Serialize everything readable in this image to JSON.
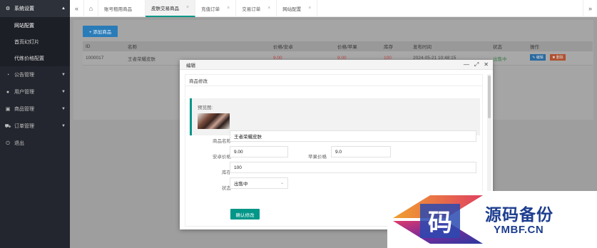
{
  "sidebar": {
    "groups": [
      {
        "label": "系统设置",
        "icon": "gear-icon",
        "arrow": "▲"
      },
      {
        "label": "公告管理",
        "icon": "bell-icon",
        "arrow": "▼"
      },
      {
        "label": "用户管理",
        "icon": "user-icon",
        "arrow": "▼"
      },
      {
        "label": "商品管理",
        "icon": "box-icon",
        "arrow": "▼"
      },
      {
        "label": "订单管理",
        "icon": "cart-icon",
        "arrow": "▼"
      },
      {
        "label": "退出",
        "icon": "power-icon",
        "arrow": ""
      }
    ],
    "sub_items": [
      {
        "label": "网站配置"
      },
      {
        "label": "首页幻灯片"
      },
      {
        "label": "代练价格配置"
      }
    ]
  },
  "topbar": {
    "prev": "«",
    "home_icon": "⌂",
    "next": "»",
    "tabs": [
      {
        "label": "账号租用商品",
        "close": ""
      },
      {
        "label": "皮肤交易商品",
        "close": "×"
      },
      {
        "label": "充值订单",
        "close": "×"
      },
      {
        "label": "交易订单",
        "close": "×"
      },
      {
        "label": "网站配置",
        "close": "×"
      }
    ]
  },
  "list": {
    "add_button": "+ 添加商品",
    "columns": [
      "ID",
      "名称",
      "价格/安卓",
      "价格/苹果",
      "库存",
      "发布时间",
      "状态",
      "操作"
    ],
    "rows": [
      {
        "id": "1000017",
        "name": "王者荣耀皮肤",
        "price_android": "9.00",
        "price_apple": "9.00",
        "stock": "100",
        "time": "2024-05-21 10:48:15",
        "status": "出售中",
        "edit": "✎ 编辑",
        "delete": "✖ 删除"
      }
    ]
  },
  "modal": {
    "title": "编辑",
    "controls": [
      "—",
      "⤢",
      "✕"
    ],
    "subtitle": "商品修改",
    "preview_label": "预览图:",
    "fields": {
      "name_label": "商品名称",
      "name_value": "王者荣耀皮肤",
      "android_label": "安卓价格",
      "android_value": "9.00",
      "apple_label": "苹果价格",
      "apple_value": "9.0",
      "stock_label": "库存",
      "stock_value": "100",
      "status_label": "状态",
      "status_value": "出售中",
      "status_arrow": "⌄"
    },
    "confirm_button": "确认修改"
  },
  "watermark": {
    "logo_char": "码",
    "text_cn": "源码备份",
    "text_en": "YMBF.CN"
  },
  "colors": {
    "sidebar_bg": "#23262e",
    "primary": "#2a7cb8",
    "accent": "#009688",
    "danger": "#b05030",
    "brand_blue": "#1d3d8f"
  }
}
